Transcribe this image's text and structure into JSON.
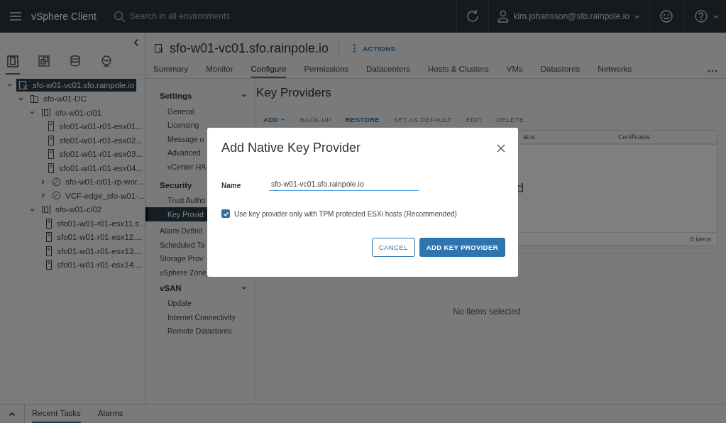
{
  "header": {
    "title": "vSphere Client",
    "search": {
      "placeholder": "Search in all environments"
    },
    "user": "kim.johansson@sfo.rainpole.io"
  },
  "inventory": {
    "tabs": [
      {
        "kind": "hosts",
        "selected": true
      },
      {
        "kind": "vms",
        "selected": false
      },
      {
        "kind": "storage",
        "selected": false
      },
      {
        "kind": "network",
        "selected": false
      }
    ],
    "tree": [
      {
        "label": "sfo-w01-vc01.sfo.rainpole.io",
        "kind": "vcenter",
        "expanded": true,
        "selected": true,
        "children": [
          {
            "label": "sfo-w01-DC",
            "kind": "datacenter",
            "expanded": true,
            "selected": false,
            "children": [
              {
                "label": "sfo-w01-cl01",
                "kind": "cluster",
                "expanded": true,
                "selected": false,
                "children": [
                  {
                    "label": "sfo01-w01-r01-esx01...",
                    "kind": "host",
                    "selected": false
                  },
                  {
                    "label": "sfo01-w01-r01-esx02...",
                    "kind": "host",
                    "selected": false
                  },
                  {
                    "label": "sfo01-w01-r01-esx03...",
                    "kind": "host",
                    "selected": false
                  },
                  {
                    "label": "sfo01-w01-r01-esx04...",
                    "kind": "host",
                    "selected": false
                  },
                  {
                    "label": "sfo-w01-cl01-rp-wor...",
                    "kind": "pool",
                    "expanded": false,
                    "selected": false
                  },
                  {
                    "label": "VCF-edge_sfo-w01-...",
                    "kind": "pool",
                    "expanded": false,
                    "selected": false
                  }
                ]
              },
              {
                "label": "sfo-w01-cl02",
                "kind": "cluster",
                "expanded": true,
                "selected": false,
                "children": [
                  {
                    "label": "sfo01-w01-r01-esx11.s...",
                    "kind": "host",
                    "selected": false
                  },
                  {
                    "label": "sfo01-w01-r01-esx12....",
                    "kind": "host",
                    "selected": false
                  },
                  {
                    "label": "sfo01-w01-r01-esx13....",
                    "kind": "host",
                    "selected": false
                  },
                  {
                    "label": "sfo01-w01-r01-esx14....",
                    "kind": "host",
                    "selected": false
                  }
                ]
              }
            ]
          }
        ]
      }
    ]
  },
  "object": {
    "title": "sfo-w01-vc01.sfo.rainpole.io",
    "actions": "ACTIONS",
    "tabs": [
      {
        "label": "Summary",
        "selected": false
      },
      {
        "label": "Monitor",
        "selected": false
      },
      {
        "label": "Configure",
        "selected": true
      },
      {
        "label": "Permissions",
        "selected": false
      },
      {
        "label": "Datacenters",
        "selected": false
      },
      {
        "label": "Hosts & Clusters",
        "selected": false
      },
      {
        "label": "VMs",
        "selected": false
      },
      {
        "label": "Datastores",
        "selected": false
      },
      {
        "label": "Networks",
        "selected": false
      }
    ]
  },
  "settings_nav": [
    {
      "kind": "section",
      "label": "Settings",
      "expanded": true,
      "items": [
        {
          "label": "General",
          "selected": false
        },
        {
          "label": "Licensing",
          "selected": false
        },
        {
          "label": "Message o",
          "selected": false
        },
        {
          "label": "Advanced",
          "selected": false
        },
        {
          "label": "vCenter HA",
          "selected": false
        }
      ]
    },
    {
      "kind": "section",
      "label": "Security",
      "items": [
        {
          "label": "Trust Autho",
          "selected": false
        },
        {
          "label": "Key Provid",
          "selected": true
        }
      ]
    },
    {
      "kind": "item",
      "label": "Alarm Definit",
      "selected": false
    },
    {
      "kind": "item",
      "label": "Scheduled Ta",
      "selected": false
    },
    {
      "kind": "item",
      "label": "Storage Prov",
      "selected": false
    },
    {
      "kind": "item",
      "label": "vSphere Zone",
      "selected": false
    },
    {
      "kind": "section",
      "label": "vSAN",
      "expanded": true,
      "items": [
        {
          "label": "Update",
          "selected": false
        },
        {
          "label": "Internet Connectivity",
          "selected": false
        },
        {
          "label": "Remote Datastores",
          "selected": false
        }
      ]
    }
  ],
  "content": {
    "title": "Key Providers",
    "toolbar": [
      {
        "label": "ADD",
        "disabled": false,
        "menu": true
      },
      {
        "label": "BACK-UP",
        "disabled": true,
        "menu": false
      },
      {
        "label": "RESTORE",
        "disabled": false,
        "menu": false
      },
      {
        "label": "SET AS DEFAULT",
        "disabled": true,
        "menu": false
      },
      {
        "label": "EDIT",
        "disabled": true,
        "menu": false
      },
      {
        "label": "DELETE",
        "disabled": true,
        "menu": false
      }
    ],
    "table": {
      "columns": [
        "atus",
        "Certificates"
      ],
      "empty_text": "d",
      "footer": "0 items"
    },
    "detail_empty": "No items selected"
  },
  "dialog": {
    "title": "Add Native Key Provider",
    "name_label": "Name",
    "name_value": "sfo-w01-vc01.sfo.rainpole.io",
    "checkbox": {
      "label": "Use key provider only with TPM protected ESXi hosts (Recommended)",
      "checked": true
    },
    "buttons": [
      {
        "label": "CANCEL",
        "kind": "secondary"
      },
      {
        "label": "ADD KEY PROVIDER",
        "kind": "primary"
      }
    ]
  },
  "bottom_tabs": [
    {
      "label": "Recent Tasks",
      "selected": true
    },
    {
      "label": "Alarms",
      "selected": false
    }
  ]
}
